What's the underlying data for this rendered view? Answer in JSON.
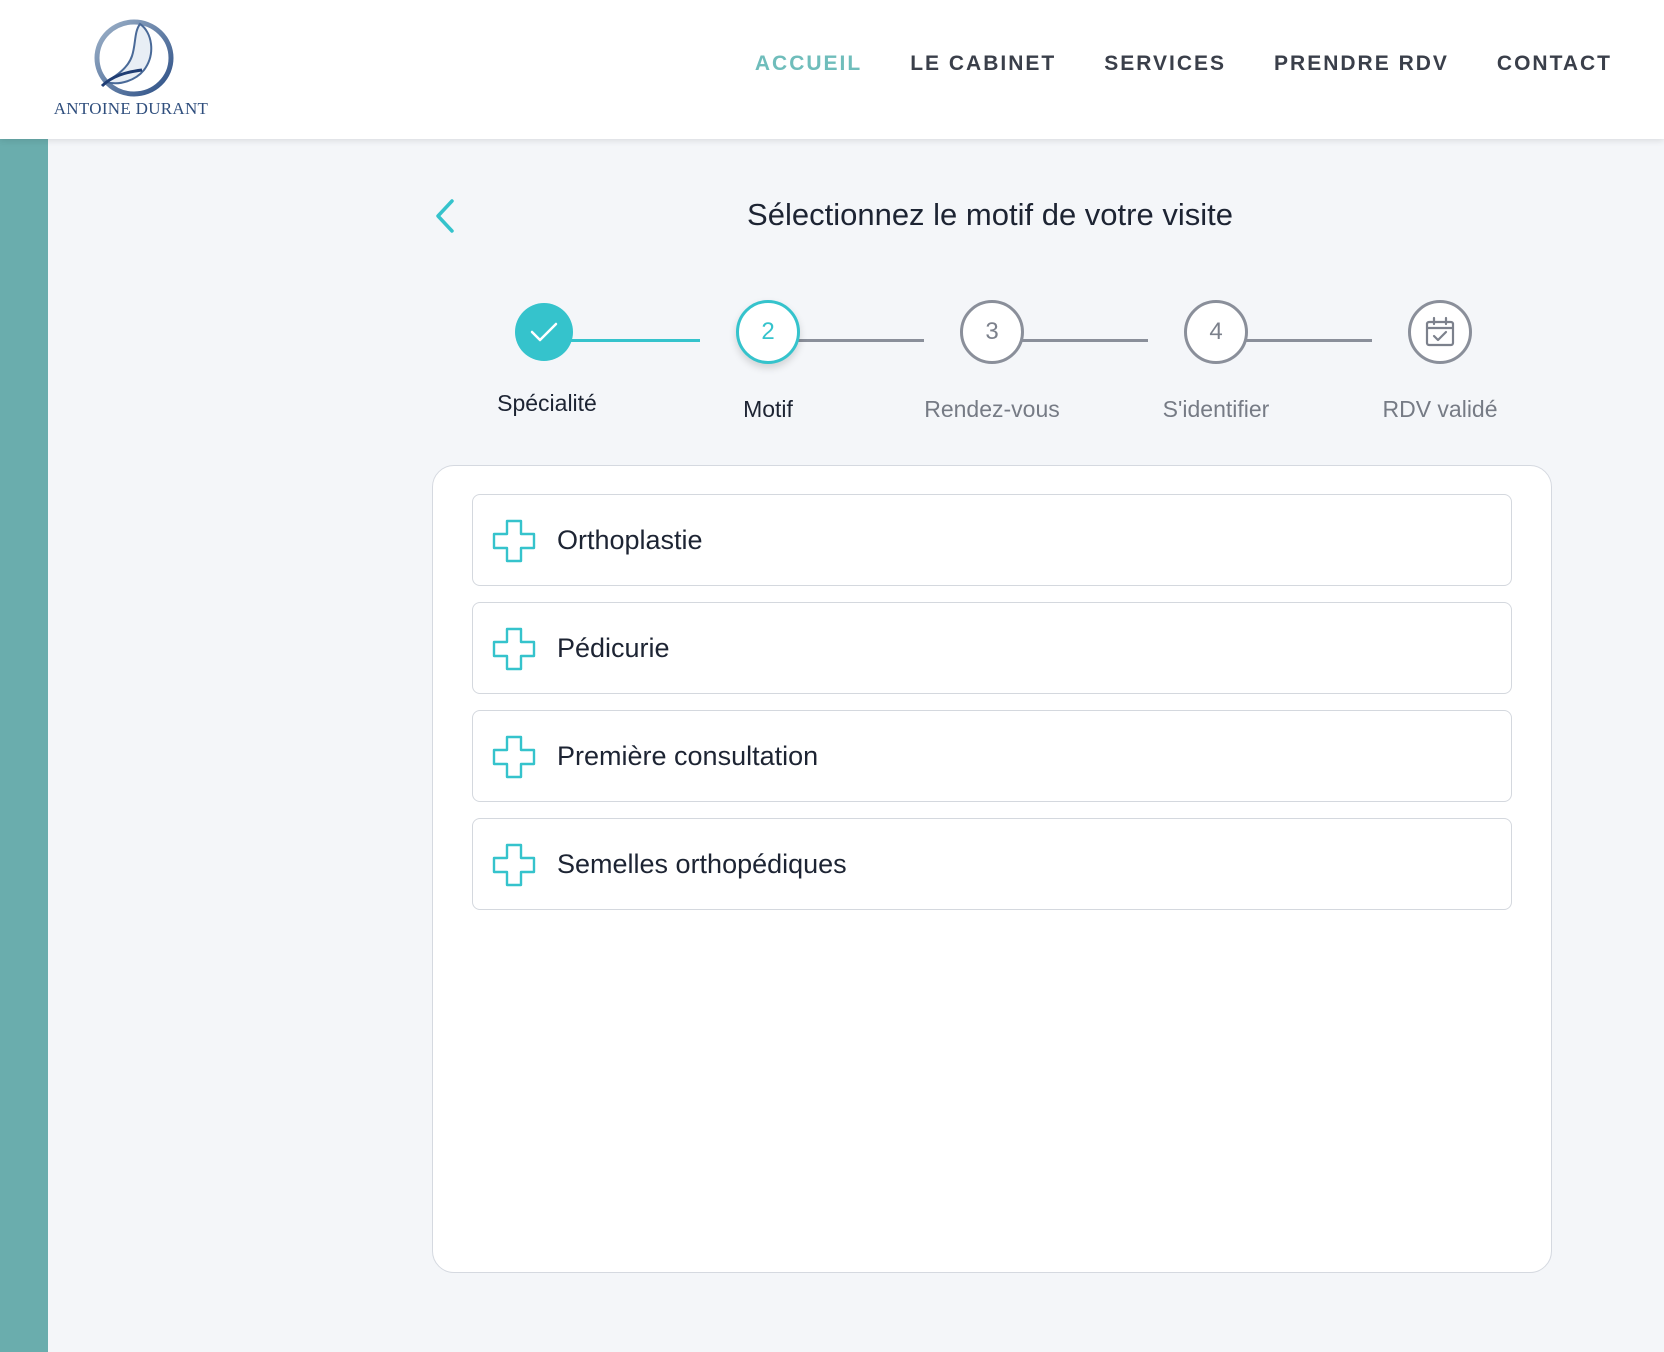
{
  "brand": {
    "name": "ANTOINE DURANT"
  },
  "nav": {
    "items": [
      {
        "label": "ACCUEIL",
        "active": true
      },
      {
        "label": "LE CABINET",
        "active": false
      },
      {
        "label": "SERVICES",
        "active": false
      },
      {
        "label": "PRENDRE RDV",
        "active": false
      },
      {
        "label": "CONTACT",
        "active": false
      }
    ]
  },
  "page": {
    "title": "Sélectionnez le motif de votre visite"
  },
  "stepper": {
    "steps": [
      {
        "label": "Spécialité",
        "state": "done",
        "icon": "check-icon"
      },
      {
        "label": "Motif",
        "number": "2",
        "state": "current"
      },
      {
        "label": "Rendez-vous",
        "number": "3",
        "state": "todo"
      },
      {
        "label": "S'identifier",
        "number": "4",
        "state": "todo"
      },
      {
        "label": "RDV validé",
        "state": "todo",
        "icon": "calendar-check-icon"
      }
    ]
  },
  "options": [
    {
      "label": "Orthoplastie",
      "icon": "plus-icon"
    },
    {
      "label": "Pédicurie",
      "icon": "plus-icon"
    },
    {
      "label": "Première consultation",
      "icon": "plus-icon"
    },
    {
      "label": "Semelles orthopédiques",
      "icon": "plus-icon"
    }
  ],
  "colors": {
    "accent": "#35c3cc",
    "nav_active": "#6fbdbb",
    "sidebar": "#6aadad",
    "text_dark": "#1d2433",
    "text_muted": "#767b85"
  }
}
